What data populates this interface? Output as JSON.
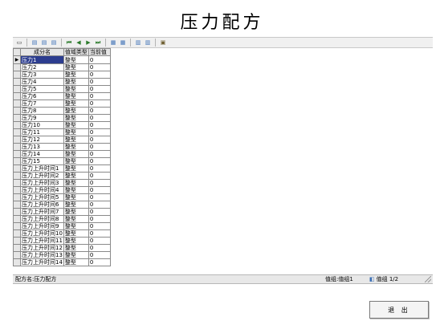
{
  "title": "压力配方",
  "toolbar": {
    "buttons": [
      {
        "icon": "open-folder-icon",
        "glyph": "▭",
        "kind": ""
      },
      {
        "icon": "new-doc-icon",
        "glyph": "▤",
        "kind": "doc"
      },
      {
        "icon": "copy-doc-icon",
        "glyph": "▤",
        "kind": "doc"
      },
      {
        "icon": "delete-doc-icon",
        "glyph": "▤",
        "kind": "doc"
      },
      {
        "icon": "first-record-icon",
        "glyph": "⏮",
        "kind": "nav"
      },
      {
        "icon": "prev-record-icon",
        "glyph": "◀",
        "kind": "nav"
      },
      {
        "icon": "next-record-icon",
        "glyph": "▶",
        "kind": "nav"
      },
      {
        "icon": "last-record-icon",
        "glyph": "⏭",
        "kind": "nav"
      },
      {
        "icon": "import-icon",
        "glyph": "▦",
        "kind": "doc"
      },
      {
        "icon": "export-icon",
        "glyph": "▦",
        "kind": "doc"
      },
      {
        "icon": "upload-icon",
        "glyph": "▥",
        "kind": "doc"
      },
      {
        "icon": "download-icon",
        "glyph": "▥",
        "kind": "doc"
      },
      {
        "icon": "save-icon",
        "glyph": "▣",
        "kind": "save"
      }
    ]
  },
  "grid": {
    "columns": [
      "成分名",
      "值域类型",
      "当前值"
    ],
    "rows": [
      {
        "name": "压力1",
        "type": "整型",
        "value": "0",
        "selected": true
      },
      {
        "name": "压力2",
        "type": "整型",
        "value": "0"
      },
      {
        "name": "压力3",
        "type": "整型",
        "value": "0"
      },
      {
        "name": "压力4",
        "type": "整型",
        "value": "0"
      },
      {
        "name": "压力5",
        "type": "整型",
        "value": "0"
      },
      {
        "name": "压力6",
        "type": "整型",
        "value": "0"
      },
      {
        "name": "压力7",
        "type": "整型",
        "value": "0"
      },
      {
        "name": "压力8",
        "type": "整型",
        "value": "0"
      },
      {
        "name": "压力9",
        "type": "整型",
        "value": "0"
      },
      {
        "name": "压力10",
        "type": "整型",
        "value": "0"
      },
      {
        "name": "压力11",
        "type": "整型",
        "value": "0"
      },
      {
        "name": "压力12",
        "type": "整型",
        "value": "0"
      },
      {
        "name": "压力13",
        "type": "整型",
        "value": "0"
      },
      {
        "name": "压力14",
        "type": "整型",
        "value": "0"
      },
      {
        "name": "压力15",
        "type": "整型",
        "value": "0"
      },
      {
        "name": "压力上升时间1",
        "type": "整型",
        "value": "0"
      },
      {
        "name": "压力上升时间2",
        "type": "整型",
        "value": "0"
      },
      {
        "name": "压力上升时间3",
        "type": "整型",
        "value": "0"
      },
      {
        "name": "压力上升时间4",
        "type": "整型",
        "value": "0"
      },
      {
        "name": "压力上升时间5",
        "type": "整型",
        "value": "0"
      },
      {
        "name": "压力上升时间6",
        "type": "整型",
        "value": "0"
      },
      {
        "name": "压力上升时间7",
        "type": "整型",
        "value": "0"
      },
      {
        "name": "压力上升时间8",
        "type": "整型",
        "value": "0"
      },
      {
        "name": "压力上升时间9",
        "type": "整型",
        "value": "0"
      },
      {
        "name": "压力上升时间10",
        "type": "整型",
        "value": "0"
      },
      {
        "name": "压力上升时间11",
        "type": "整型",
        "value": "0"
      },
      {
        "name": "压力上升时间12",
        "type": "整型",
        "value": "0"
      },
      {
        "name": "压力上升时间13",
        "type": "整型",
        "value": "0"
      },
      {
        "name": "压力上升时间14",
        "type": "整型",
        "value": "0"
      }
    ]
  },
  "status": {
    "recipe_name": "配方名:压力配方",
    "value_group": "值组:值组1",
    "page": "值组 1/2"
  },
  "exit_label": "退 出",
  "colors": {
    "selection": "#2c3d8f",
    "header_bg": "#e6e6e6",
    "grid_line": "#8a8a8a"
  }
}
